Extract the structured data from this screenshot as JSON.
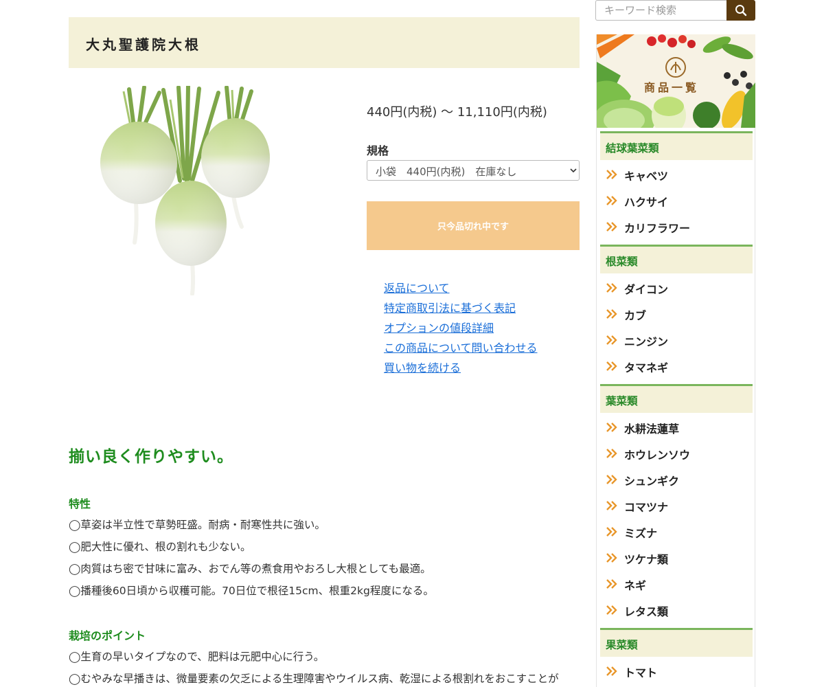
{
  "product": {
    "title": "大丸聖護院大根",
    "price": "440円(内税) 〜 11,110円(内税)",
    "spec_label": "規格",
    "spec_selected": "小袋　440円(内税)　在庫なし",
    "soldout_label": "只今品切れ中です"
  },
  "links": [
    "返品について",
    "特定商取引法に基づく表記",
    "オプションの値段詳細",
    "この商品について問い合わせる",
    "買い物を続ける"
  ],
  "description": {
    "catch": "揃い良く作りやすい。",
    "sections": [
      {
        "heading": "特性",
        "lines": [
          "◯草姿は半立性で草勢旺盛。耐病・耐寒性共に強い。",
          "◯肥大性に優れ、根の割れも少ない。",
          "◯肉質はち密で甘味に富み、おでん等の煮食用やおろし大根としても最適。",
          "◯播種後60日頃から収穫可能。70日位で根径15cm、根重2kg程度になる。"
        ]
      },
      {
        "heading": "栽培のポイント",
        "lines": [
          "◯生育の早いタイプなので、肥料は元肥中心に行う。",
          "◯むやみな早播きは、微量要素の欠乏による生理障害やウイルス病、乾湿による根割れをおこすことが"
        ]
      }
    ]
  },
  "search": {
    "placeholder": "キーワード検索",
    "icon": "search-icon"
  },
  "sidebar": {
    "banner_label": "商品一覧",
    "categories": [
      {
        "name": "結球葉菜類",
        "items": [
          "キャベツ",
          "ハクサイ",
          "カリフラワー"
        ]
      },
      {
        "name": "根菜類",
        "items": [
          "ダイコン",
          "カブ",
          "ニンジン",
          "タマネギ"
        ]
      },
      {
        "name": "葉菜類",
        "items": [
          "水耕法蓮草",
          "ホウレンソウ",
          "シュンギク",
          "コマツナ",
          "ミズナ",
          "ツケナ類",
          "ネギ",
          "レタス類"
        ]
      },
      {
        "name": "果菜類",
        "items": [
          "トマト"
        ]
      }
    ]
  },
  "colors": {
    "title_bg": "#f4f1d8",
    "soldout_bg": "#f5c98d",
    "link": "#1a6ed8",
    "green_heading": "#1e8c1e",
    "search_button": "#5a3a0f",
    "category_border": "#7ab55c",
    "chevron": "#e8962a"
  }
}
